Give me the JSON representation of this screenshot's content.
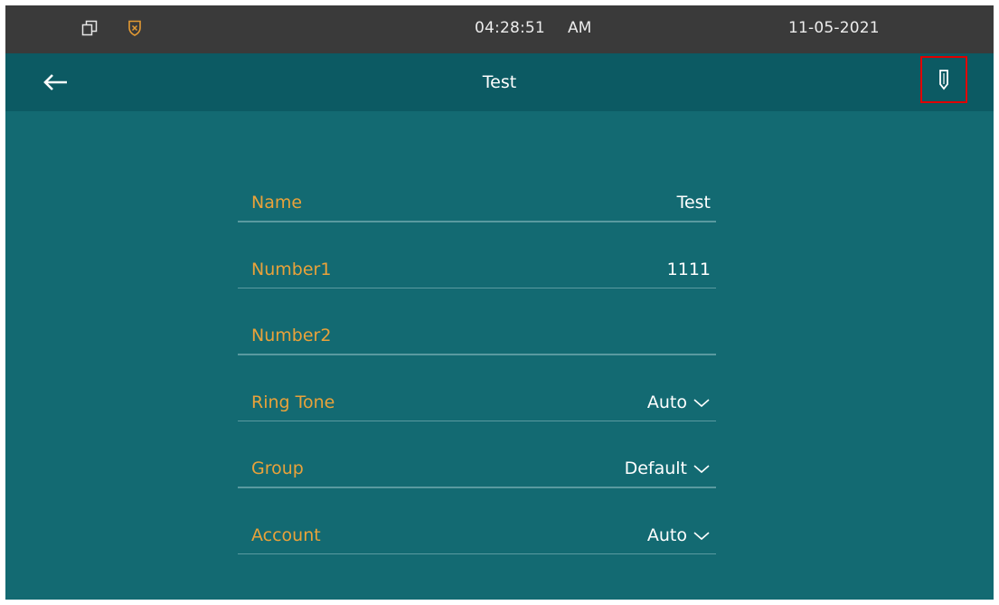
{
  "status_bar": {
    "time": "04:28:51",
    "ampm": "AM",
    "date": "11-05-2021",
    "icons": [
      "window-restore-icon",
      "shield-icon"
    ]
  },
  "header": {
    "title": "Test",
    "back_icon": "back-arrow-icon",
    "edit_icon": "pencil-icon",
    "highlight_color": "#e00000"
  },
  "form": {
    "fields": [
      {
        "label": "Name",
        "value": "Test"
      },
      {
        "label": "Number1",
        "value": "1111"
      },
      {
        "label": "Number2",
        "value": ""
      },
      {
        "label": "Ring Tone",
        "value": "Auto"
      },
      {
        "label": "Group",
        "value": "Default"
      },
      {
        "label": "Account",
        "value": "Auto"
      }
    ]
  },
  "colors": {
    "background": "#136a72",
    "title_bar": "#0c5a63",
    "status_bar": "#3a3a3a",
    "label": "#e9a23a",
    "value": "#ffffff"
  }
}
